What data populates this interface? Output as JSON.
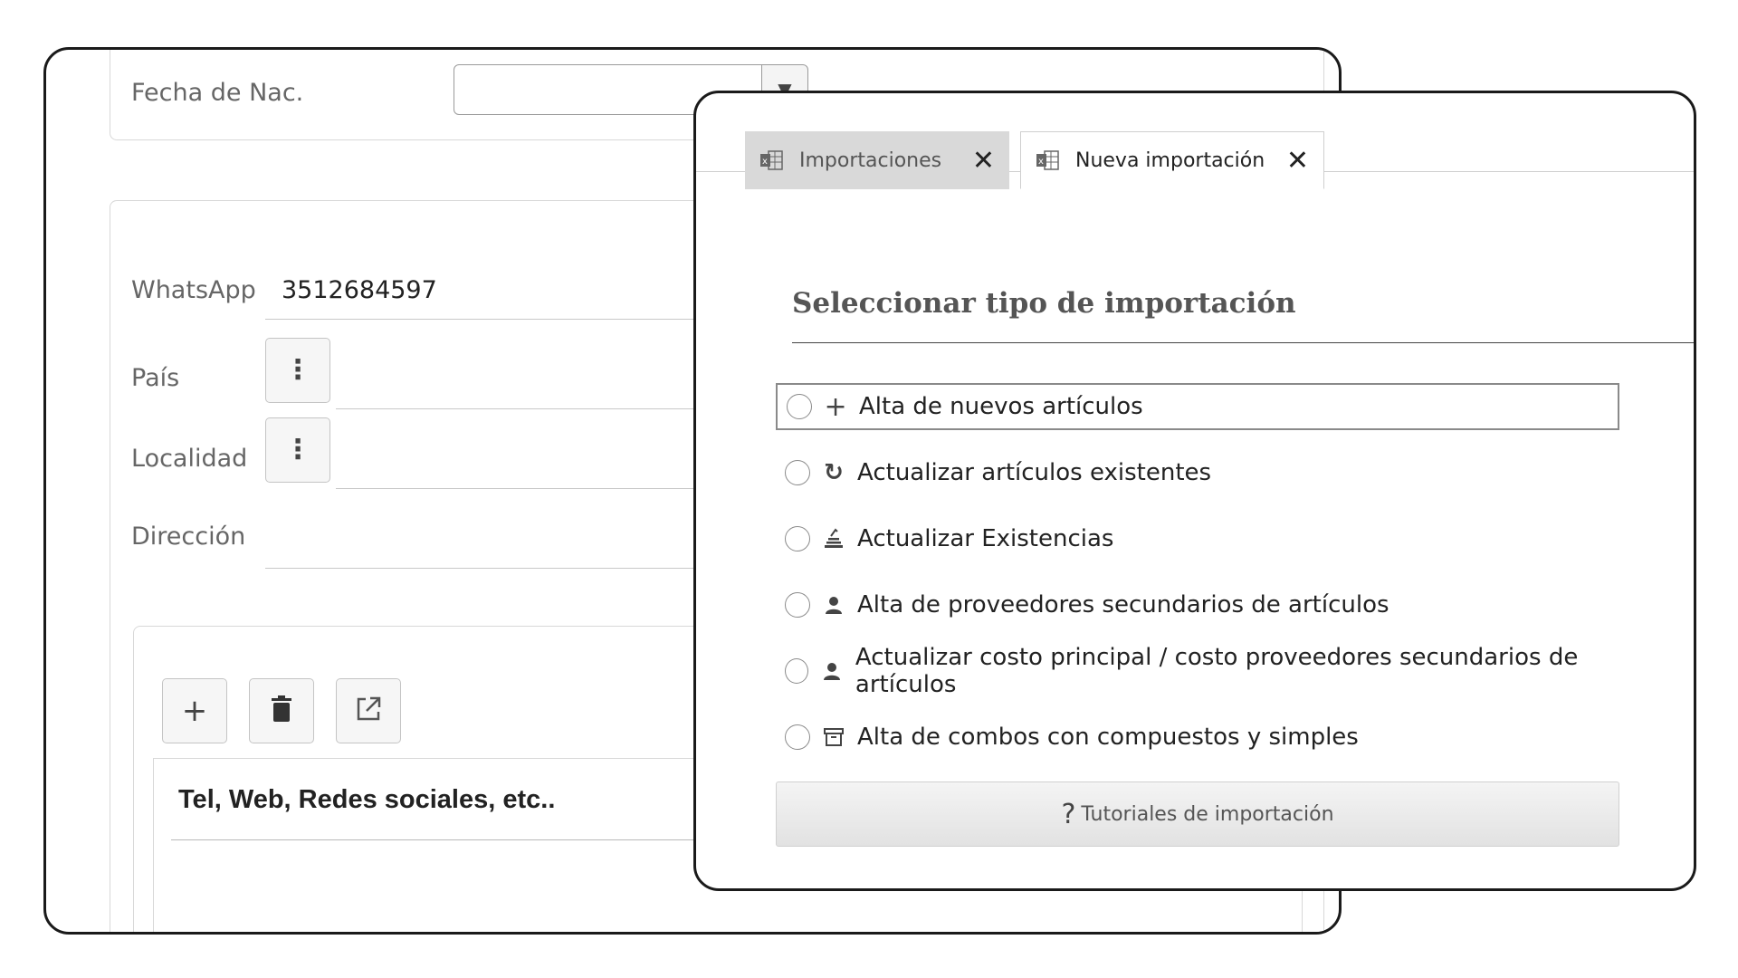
{
  "back_form": {
    "birth_date_label": "Fecha de Nac.",
    "birth_date_value": "",
    "whatsapp_label": "WhatsApp",
    "whatsapp_value": "3512684597",
    "country_label": "País",
    "locality_label": "Localidad",
    "address_label": "Dirección",
    "contacts_table": {
      "header": "Tel, Web, Redes sociales, etc.."
    }
  },
  "import_dialog": {
    "tabs": [
      {
        "label": "Importaciones",
        "close": "✕",
        "icon": "excel-icon",
        "active": false
      },
      {
        "label": "Nueva importación",
        "close": "✕",
        "icon": "excel-icon",
        "active": true
      }
    ],
    "section_title": "Seleccionar tipo de importación",
    "options": [
      {
        "label": "Alta de nuevos artículos",
        "icon": "plus-icon",
        "glyph": "+"
      },
      {
        "label": "Actualizar artículos existentes",
        "icon": "refresh-icon",
        "glyph": "↻"
      },
      {
        "label": "Actualizar Existencias",
        "icon": "stack-icon",
        "glyph": ""
      },
      {
        "label": "Alta de proveedores secundarios de artículos",
        "icon": "person-icon",
        "glyph": ""
      },
      {
        "label": "Actualizar costo principal / costo proveedores secundarios de artículos",
        "icon": "person-icon",
        "glyph": ""
      },
      {
        "label": "Alta de combos con compuestos y simples",
        "icon": "archive-icon",
        "glyph": ""
      }
    ],
    "tutorial_button": {
      "label": "Tutoriales de importación",
      "icon": "question-icon",
      "glyph": "?"
    }
  }
}
